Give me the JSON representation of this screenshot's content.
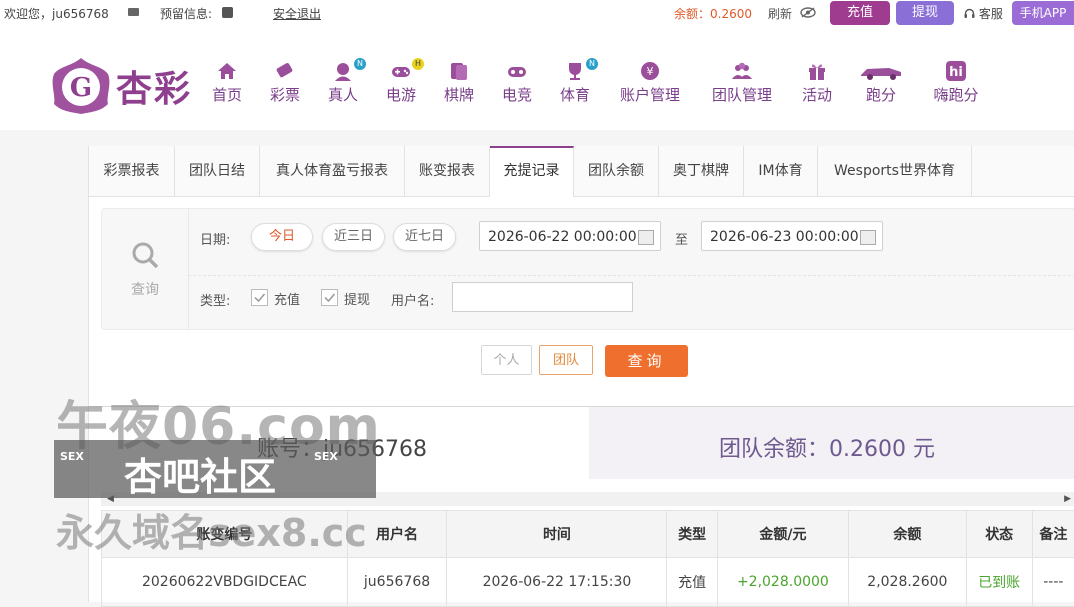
{
  "topbar": {
    "welcome": "欢迎您，ju656768",
    "reserve_label": "预留信息:",
    "logout": "安全退出",
    "balance_label": "余额：0.2600",
    "refresh": "刷新",
    "charge": "充值",
    "withdraw": "提现",
    "service": "客服",
    "app": "手机APP"
  },
  "brand": {
    "logo_text": "杏彩"
  },
  "nav": [
    {
      "label": "首页",
      "icon": "home-icon"
    },
    {
      "label": "彩票",
      "icon": "lottery-icon"
    },
    {
      "label": "真人",
      "icon": "live-dealer-icon",
      "badge": "N"
    },
    {
      "label": "电游",
      "icon": "gamepad-icon",
      "badge": "H"
    },
    {
      "label": "棋牌",
      "icon": "cards-icon"
    },
    {
      "label": "电竞",
      "icon": "esports-icon"
    },
    {
      "label": "体育",
      "icon": "trophy-icon",
      "badge": "N"
    },
    {
      "label": "账户管理",
      "icon": "yen-icon"
    },
    {
      "label": "团队管理",
      "icon": "team-icon"
    },
    {
      "label": "活动",
      "icon": "gift-icon"
    },
    {
      "label": "跑分",
      "icon": "car-icon"
    },
    {
      "label": "嗨跑分",
      "icon": "hi-icon"
    }
  ],
  "tabs": [
    "彩票报表",
    "团队日结",
    "真人体育盈亏报表",
    "账变报表",
    "充提记录",
    "团队余额",
    "奥丁棋牌",
    "IM体育",
    "Wesports世界体育"
  ],
  "active_tab": "充提记录",
  "filter": {
    "query_label": "查询",
    "date_label": "日期:",
    "quick": [
      "今日",
      "近三日",
      "近七日"
    ],
    "start": "2026-06-22 00:00:00",
    "to": "至",
    "end": "2026-06-23 00:00:00",
    "type_label": "类型:",
    "type_charge": "充值",
    "type_withdraw": "提现",
    "username_label": "用户名:",
    "username_value": ""
  },
  "actions": {
    "personal": "个人",
    "team": "团队",
    "search": "查询"
  },
  "summary": {
    "account": "账号：ju656768",
    "team_balance": "团队余额：0.2600 元"
  },
  "table": {
    "headers": [
      "账变编号",
      "用户名",
      "时间",
      "类型",
      "金额/元",
      "余额",
      "状态",
      "备注"
    ],
    "rows": [
      [
        "20260622VBDGIDCEAC",
        "ju656768",
        "2026-06-22 17:15:30",
        "充值",
        "+2,028.0000",
        "2,028.2600",
        "已到账",
        "----"
      ]
    ]
  },
  "watermark": {
    "line1": "午夜06.com",
    "brand": "杏吧社区",
    "sex": "SEX",
    "line3": "永久域名sex8.cc"
  },
  "colors": {
    "accent": "#8e3f8e",
    "orange": "#ef6f2e",
    "green": "#4aa52e"
  }
}
